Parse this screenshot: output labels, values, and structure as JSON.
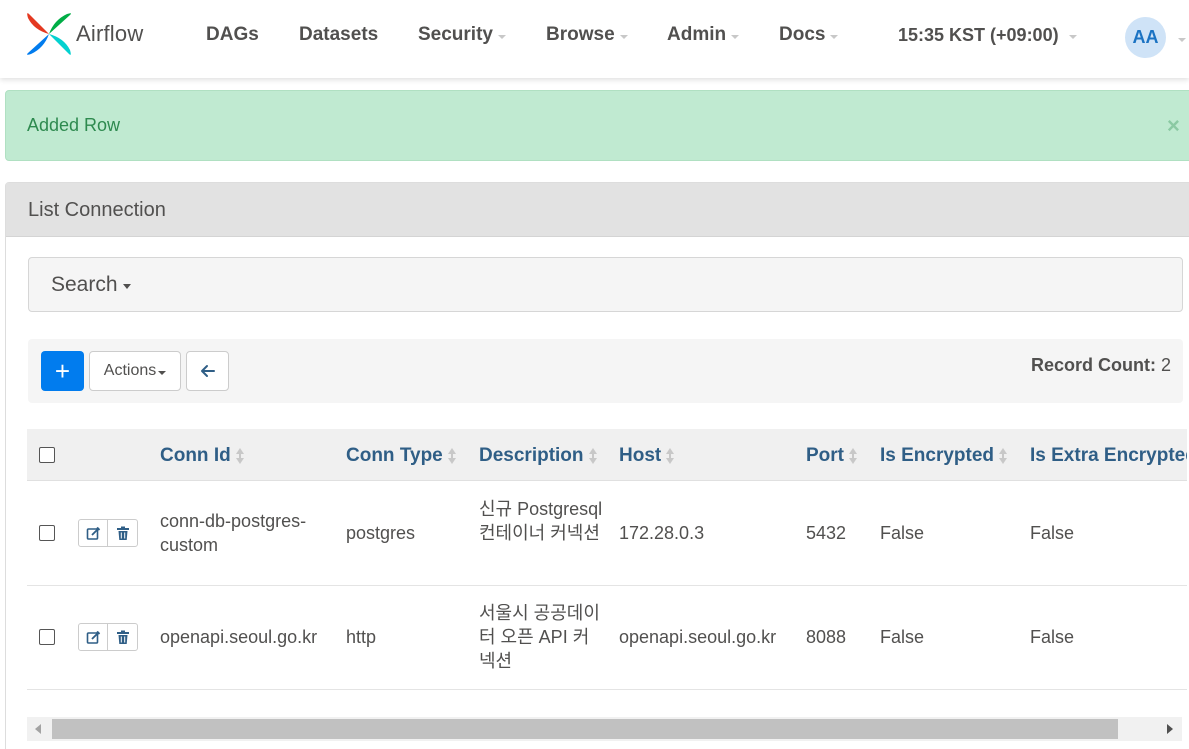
{
  "navbar": {
    "brand": "Airflow",
    "menu": [
      {
        "label": "DAGs",
        "dropdown": false
      },
      {
        "label": "Datasets",
        "dropdown": false
      },
      {
        "label": "Security",
        "dropdown": true
      },
      {
        "label": "Browse",
        "dropdown": true
      },
      {
        "label": "Admin",
        "dropdown": true
      },
      {
        "label": "Docs",
        "dropdown": true
      }
    ],
    "time": "15:35 KST (+09:00)",
    "avatar": "AA"
  },
  "alert": {
    "message": "Added Row",
    "close": "×",
    "color": "#c0ead1"
  },
  "panel": {
    "title": "List Connection",
    "search_label": "Search",
    "toolbar": {
      "add_label": "+",
      "actions_label": "Actions",
      "record_count_label": "Record Count:",
      "record_count_value": "2"
    }
  },
  "table": {
    "columns": [
      "Conn Id",
      "Conn Type",
      "Description",
      "Host",
      "Port",
      "Is Encrypted",
      "Is Extra Encrypted"
    ],
    "rows": [
      {
        "conn_id": "conn-db-postgres-custom",
        "conn_type": "postgres",
        "description": "신규 Postgresql 컨테이너 커넥션",
        "host": "172.28.0.3",
        "port": "5432",
        "is_encrypted": "False",
        "is_extra_encrypted": "False"
      },
      {
        "conn_id": "openapi.seoul.go.kr",
        "conn_type": "http",
        "description": "서울시 공공데이터 오픈 API 커넥션",
        "host": "openapi.seoul.go.kr",
        "port": "8088",
        "is_encrypted": "False",
        "is_extra_encrypted": "False"
      }
    ]
  },
  "colors": {
    "primary": "#017cee",
    "header_link": "#2f5e86",
    "alert_text": "#2e8a4f"
  }
}
